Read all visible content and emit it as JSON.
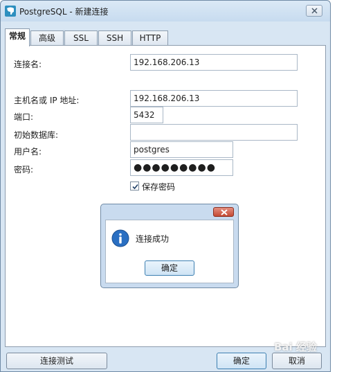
{
  "window": {
    "title": "PostgreSQL - 新建连接"
  },
  "tabs": [
    "常规",
    "高级",
    "SSL",
    "SSH",
    "HTTP"
  ],
  "form": {
    "connection_name_label": "连接名:",
    "connection_name_value": "192.168.206.13",
    "host_label": "主机名或 IP 地址:",
    "host_value": "192.168.206.13",
    "port_label": "端口:",
    "port_value": "5432",
    "initial_db_label": "初始数据库:",
    "initial_db_value": "",
    "username_label": "用户名:",
    "username_value": "postgres",
    "password_label": "密码:",
    "password_value": "●●●●●●●●●",
    "save_password_label": "保存密码",
    "save_password_checked": true
  },
  "dialog": {
    "message": "连接成功",
    "ok_label": "确定"
  },
  "buttons": {
    "test_label": "连接测试",
    "ok_label": "确定",
    "cancel_label": "取消"
  },
  "watermark": "Bai 经验",
  "colors": {
    "accent": "#3c7fb1",
    "window_frame": "#d8e6f3",
    "dialog_close": "#c44a33",
    "info_blue": "#2a6fc2"
  }
}
